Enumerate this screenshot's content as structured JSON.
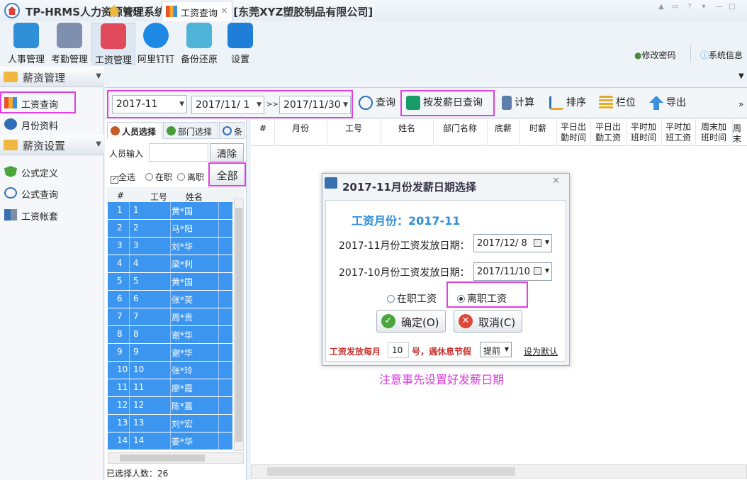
{
  "window": {
    "title": "TP-HRMS人力资源管理系统专业版-授权：[东莞XYZ塑胶制品有限公司]"
  },
  "toolbar": {
    "items": [
      {
        "label": "人事管理",
        "icon": "people-icon"
      },
      {
        "label": "考勤管理",
        "icon": "calendar-icon"
      },
      {
        "label": "工资管理",
        "icon": "payroll-icon"
      },
      {
        "label": "阿里钉钉",
        "icon": "dingtalk-icon"
      },
      {
        "label": "备份还原",
        "icon": "cloud-icon"
      },
      {
        "label": "设置",
        "icon": "gear-icon"
      }
    ],
    "change_password": "修改密码",
    "system_info": "系统信息"
  },
  "leftnav": {
    "group1": "薪资管理",
    "item_salary_query": "工资查询",
    "item_monthly": "月份资料",
    "group2": "薪资设置",
    "item_formula_def": "公式定义",
    "item_formula_query": "公式查询",
    "item_salary_set": "工资帐套"
  },
  "tabs": {
    "home": "开始",
    "salary_query": "工资查询",
    "close": "×"
  },
  "filter": {
    "month": "2017-11",
    "date_from": "2017/11/  1",
    "range_sep": ">>",
    "date_to": "2017/11/30",
    "query": "查询",
    "payday_query": "按发薪日查询",
    "calculate": "计算",
    "sort": "排序",
    "columns": "栏位",
    "export": "导出"
  },
  "emp_panel": {
    "tab_person": "人员选择",
    "tab_dept": "部门选择",
    "tab_cond": "条",
    "input_label": "人员输入",
    "clear": "清除",
    "select_all": "全选",
    "active": "在职",
    "left": "离职",
    "all": "全部",
    "headers": [
      "#",
      "工号",
      "姓名"
    ],
    "rows": [
      [
        "1",
        "1",
        "黄*国"
      ],
      [
        "2",
        "2",
        "马*阳"
      ],
      [
        "3",
        "3",
        "刘*华"
      ],
      [
        "4",
        "4",
        "梁*利"
      ],
      [
        "5",
        "5",
        "黄*国"
      ],
      [
        "6",
        "6",
        "张*英"
      ],
      [
        "7",
        "7",
        "周*贵"
      ],
      [
        "8",
        "8",
        "谢*华"
      ],
      [
        "9",
        "9",
        "谢*华"
      ],
      [
        "10",
        "10",
        "张*玲"
      ],
      [
        "11",
        "11",
        "廖*霞"
      ],
      [
        "12",
        "12",
        "陈*嘉"
      ],
      [
        "13",
        "13",
        "刘*宏"
      ],
      [
        "14",
        "14",
        "姜*华"
      ]
    ],
    "selected_count": "已选择人数：26"
  },
  "main_grid": {
    "headers": [
      "#",
      "月份",
      "工号",
      "姓名",
      "部门名称",
      "底薪",
      "时薪",
      "平日出\n勤时间",
      "平日出\n勤工资",
      "平时加\n班时间",
      "平时加\n班工资",
      "周末加\n班时间",
      "周末"
    ]
  },
  "dialog": {
    "title": "2017-11月份发薪日期选择",
    "salary_month": "工资月份：2017-11",
    "label_nov": "2017-11月份工资发放日期：",
    "nov_date": "2017/12/  8",
    "label_oct": "2017-10月份工资发放日期：",
    "oct_date": "2017/11/10",
    "radio_active": "在职工资",
    "radio_left": "离职工资",
    "ok": "确定(O)",
    "cancel": "取消(C)",
    "payday_prefix": "工资发放每月",
    "payday_value": "10",
    "payday_suffix": "号，遇休息节假",
    "holiday_option": "提前",
    "set_default": "设为默认"
  },
  "annotation": "注意事先设置好发薪日期",
  "colors": {
    "accent_pink": "#e040e0",
    "row_blue": "#3c96f0",
    "title_blue": "#2f8fd8"
  }
}
